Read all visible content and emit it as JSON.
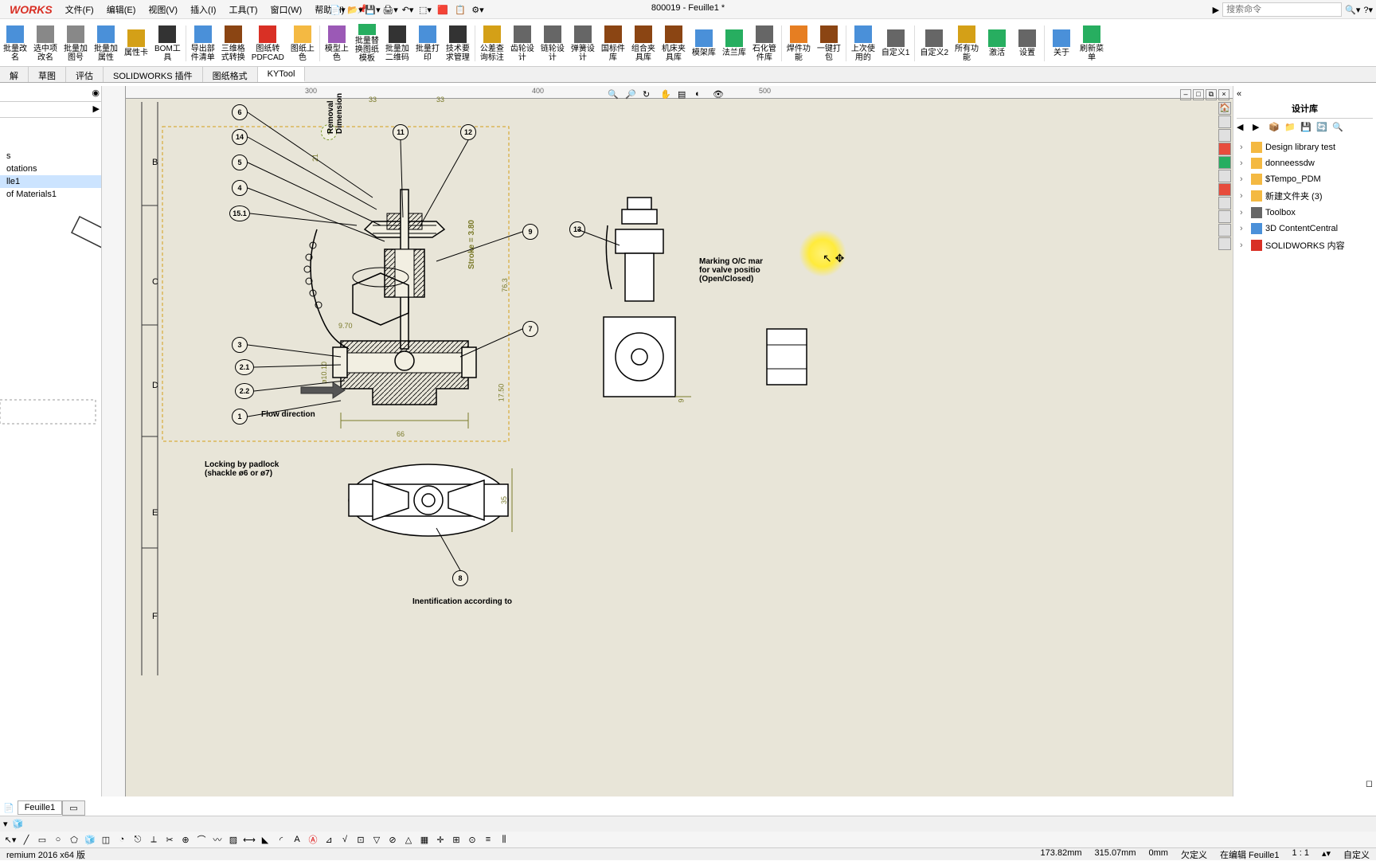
{
  "app": {
    "logo": "WORKS",
    "title": "800019 - Feuille1 *"
  },
  "menu": {
    "file": "文件(F)",
    "edit": "编辑(E)",
    "view": "视图(V)",
    "insert": "插入(I)",
    "tools": "工具(T)",
    "window": "窗口(W)",
    "help": "帮助(H)"
  },
  "search": {
    "placeholder": "搜索命令"
  },
  "ribbon": {
    "items": [
      {
        "label": "批量改\n名"
      },
      {
        "label": "选中项\n改名"
      },
      {
        "label": "批量加\n图号"
      },
      {
        "label": "批量加\n属性"
      },
      {
        "label": "属性卡"
      },
      {
        "label": "BOM工\n具"
      },
      {
        "label": "导出部\n件清单"
      },
      {
        "label": "三维格\n式转换"
      },
      {
        "label": "图纸转\nPDFCAD"
      },
      {
        "label": "图纸上\n色"
      },
      {
        "label": "模型上\n色"
      },
      {
        "label": "批量替\n换图纸\n模板"
      },
      {
        "label": "批量加\n二维码"
      },
      {
        "label": "批量打\n印"
      },
      {
        "label": "技术要\n求管理"
      },
      {
        "label": "公差查\n询标注"
      },
      {
        "label": "齿轮设\n计"
      },
      {
        "label": "链轮设\n计"
      },
      {
        "label": "弹簧设\n计"
      },
      {
        "label": "国标件\n库"
      },
      {
        "label": "组合夹\n具库"
      },
      {
        "label": "机床夹\n具库"
      },
      {
        "label": "模架库"
      },
      {
        "label": "法兰库"
      },
      {
        "label": "石化管\n件库"
      },
      {
        "label": "焊件功\n能"
      },
      {
        "label": "一键打\n包"
      },
      {
        "label": "上次使\n用的"
      },
      {
        "label": "自定义1"
      },
      {
        "label": "自定义2"
      },
      {
        "label": "所有功\n能"
      },
      {
        "label": "激活"
      },
      {
        "label": "设置"
      },
      {
        "label": "关于"
      },
      {
        "label": "刷新菜\n单"
      }
    ]
  },
  "tabs": {
    "items": [
      "解",
      "草图",
      "评估",
      "SOLIDWORKS 插件",
      "图纸格式",
      "KYTool"
    ]
  },
  "tree": {
    "items": [
      "s",
      "otations",
      "lle1",
      "of Materials1"
    ]
  },
  "designLib": {
    "title": "设计库",
    "items": [
      {
        "label": "Design library test"
      },
      {
        "label": "donneessdw"
      },
      {
        "label": "$Tempo_PDM"
      },
      {
        "label": "新建文件夹 (3)"
      },
      {
        "label": "Toolbox"
      },
      {
        "label": "3D ContentCentral"
      },
      {
        "label": "SOLIDWORKS 内容"
      }
    ]
  },
  "drawing": {
    "balloons": [
      "6",
      "14",
      "5",
      "4",
      "15.1",
      "3",
      "2.1",
      "2.2",
      "1",
      "11",
      "12",
      "9",
      "7",
      "13",
      "8"
    ],
    "callouts": {
      "removal": "Removal\nDimension",
      "stroke": "Stroke = 3.80",
      "marking": "Marking O/C mar\nfor valve positio\n(Open/Closed)",
      "flow": "Flow direction",
      "locking": "Locking by padlock\n(shackle ø6 or ø7)",
      "ident": "Inentification according to"
    },
    "dims": {
      "d33a": "33",
      "d33b": "33",
      "d21": "21",
      "d970": "9.70",
      "d1010": "ø10.10",
      "d66": "66",
      "d1750": "17.50",
      "d763": "76.3",
      "d35": "35",
      "d9": "9"
    },
    "ruler": {
      "r300": "300",
      "r400": "400",
      "r500": "500"
    },
    "rows": [
      "B",
      "C",
      "D",
      "E",
      "F"
    ]
  },
  "sheetTab": {
    "name": "Feuille1"
  },
  "status": {
    "version": "remium 2016 x64 版",
    "x": "173.82mm",
    "y": "315.07mm",
    "z": "0mm",
    "def": "欠定义",
    "edit": "在编辑 Feuille1",
    "scale": "1 : 1",
    "custom": "自定义"
  }
}
